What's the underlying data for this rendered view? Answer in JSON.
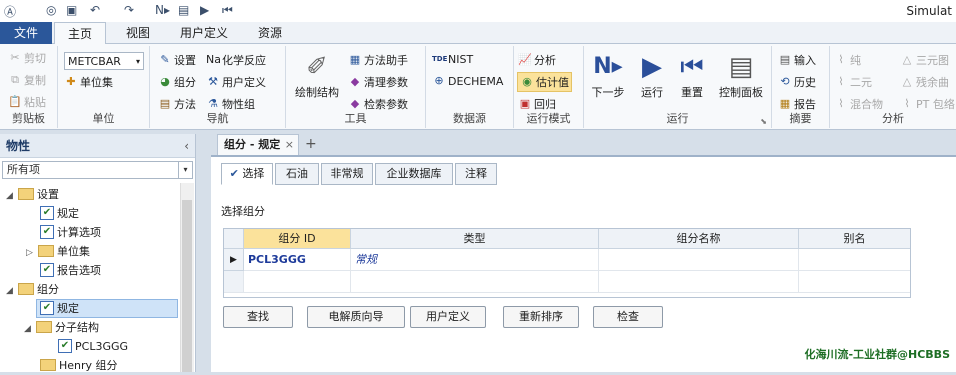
{
  "window": {
    "title": "Simulat"
  },
  "ribbon_tabs": [
    "文件",
    "主页",
    "视图",
    "用户定义",
    "资源"
  ],
  "clipboard": {
    "cut": "剪切",
    "copy": "复制",
    "paste": "粘贴",
    "label": "剪贴板"
  },
  "units": {
    "value": "METCBAR",
    "unit_sets": "单位集",
    "label": "单位"
  },
  "navigation": {
    "setup": "设置",
    "components": "组分",
    "methods": "方法",
    "chemistry": "化学反应",
    "user_defined": "用户定义",
    "properties": "物性组",
    "label": "导航"
  },
  "tools": {
    "draw_structure": "绘制结构",
    "methods_assistant": "方法助手",
    "clean_params": "清理参数",
    "retrieve_params": "检索参数",
    "label": "工具"
  },
  "datasource": {
    "nist": "NIST",
    "dechema": "DECHEMA",
    "label": "数据源"
  },
  "run_mode": {
    "analysis": "分析",
    "estimation": "估计值",
    "regression": "回归",
    "label": "运行模式"
  },
  "run": {
    "next": "下一步",
    "run": "运行",
    "reset": "重置",
    "control_panel": "控制面板",
    "label": "运行"
  },
  "summary": {
    "input": "输入",
    "history": "历史",
    "report": "报告",
    "label": "摘要"
  },
  "analysis": {
    "pure": "纯",
    "binary": "二元",
    "mixture": "混合物",
    "ternary": "三元图",
    "residue": "残余曲",
    "pt_envelope": "PT 包络",
    "label": "分析"
  },
  "nav_panel": {
    "title": "物性",
    "filter": "所有项"
  },
  "tree": [
    {
      "label": "设置"
    },
    {
      "label": "规定"
    },
    {
      "label": "计算选项"
    },
    {
      "label": "单位集"
    },
    {
      "label": "报告选项"
    },
    {
      "label": "组分"
    },
    {
      "label": "规定"
    },
    {
      "label": "分子结构"
    },
    {
      "label": "PCL3GGG"
    },
    {
      "label": "Henry 组分"
    }
  ],
  "doc_tab": {
    "label": "组分 - 规定",
    "close": "×",
    "add": "+"
  },
  "subtabs": [
    "选择",
    "石油",
    "非常规",
    "企业数据库",
    "注释"
  ],
  "section_label": "选择组分",
  "grid": {
    "headers": [
      "组分 ID",
      "类型",
      "组分名称",
      "别名"
    ],
    "rows": [
      {
        "id": "PCL3GGG",
        "type": "常规",
        "name": "",
        "alias": ""
      }
    ]
  },
  "buttons": [
    "查找",
    "电解质向导",
    "用户定义",
    "重新排序",
    "检查"
  ],
  "watermark": "化海川流-工业社群@HCBBS",
  "colors": {
    "accent": "#2b579a",
    "selected": "#fbe29b"
  }
}
